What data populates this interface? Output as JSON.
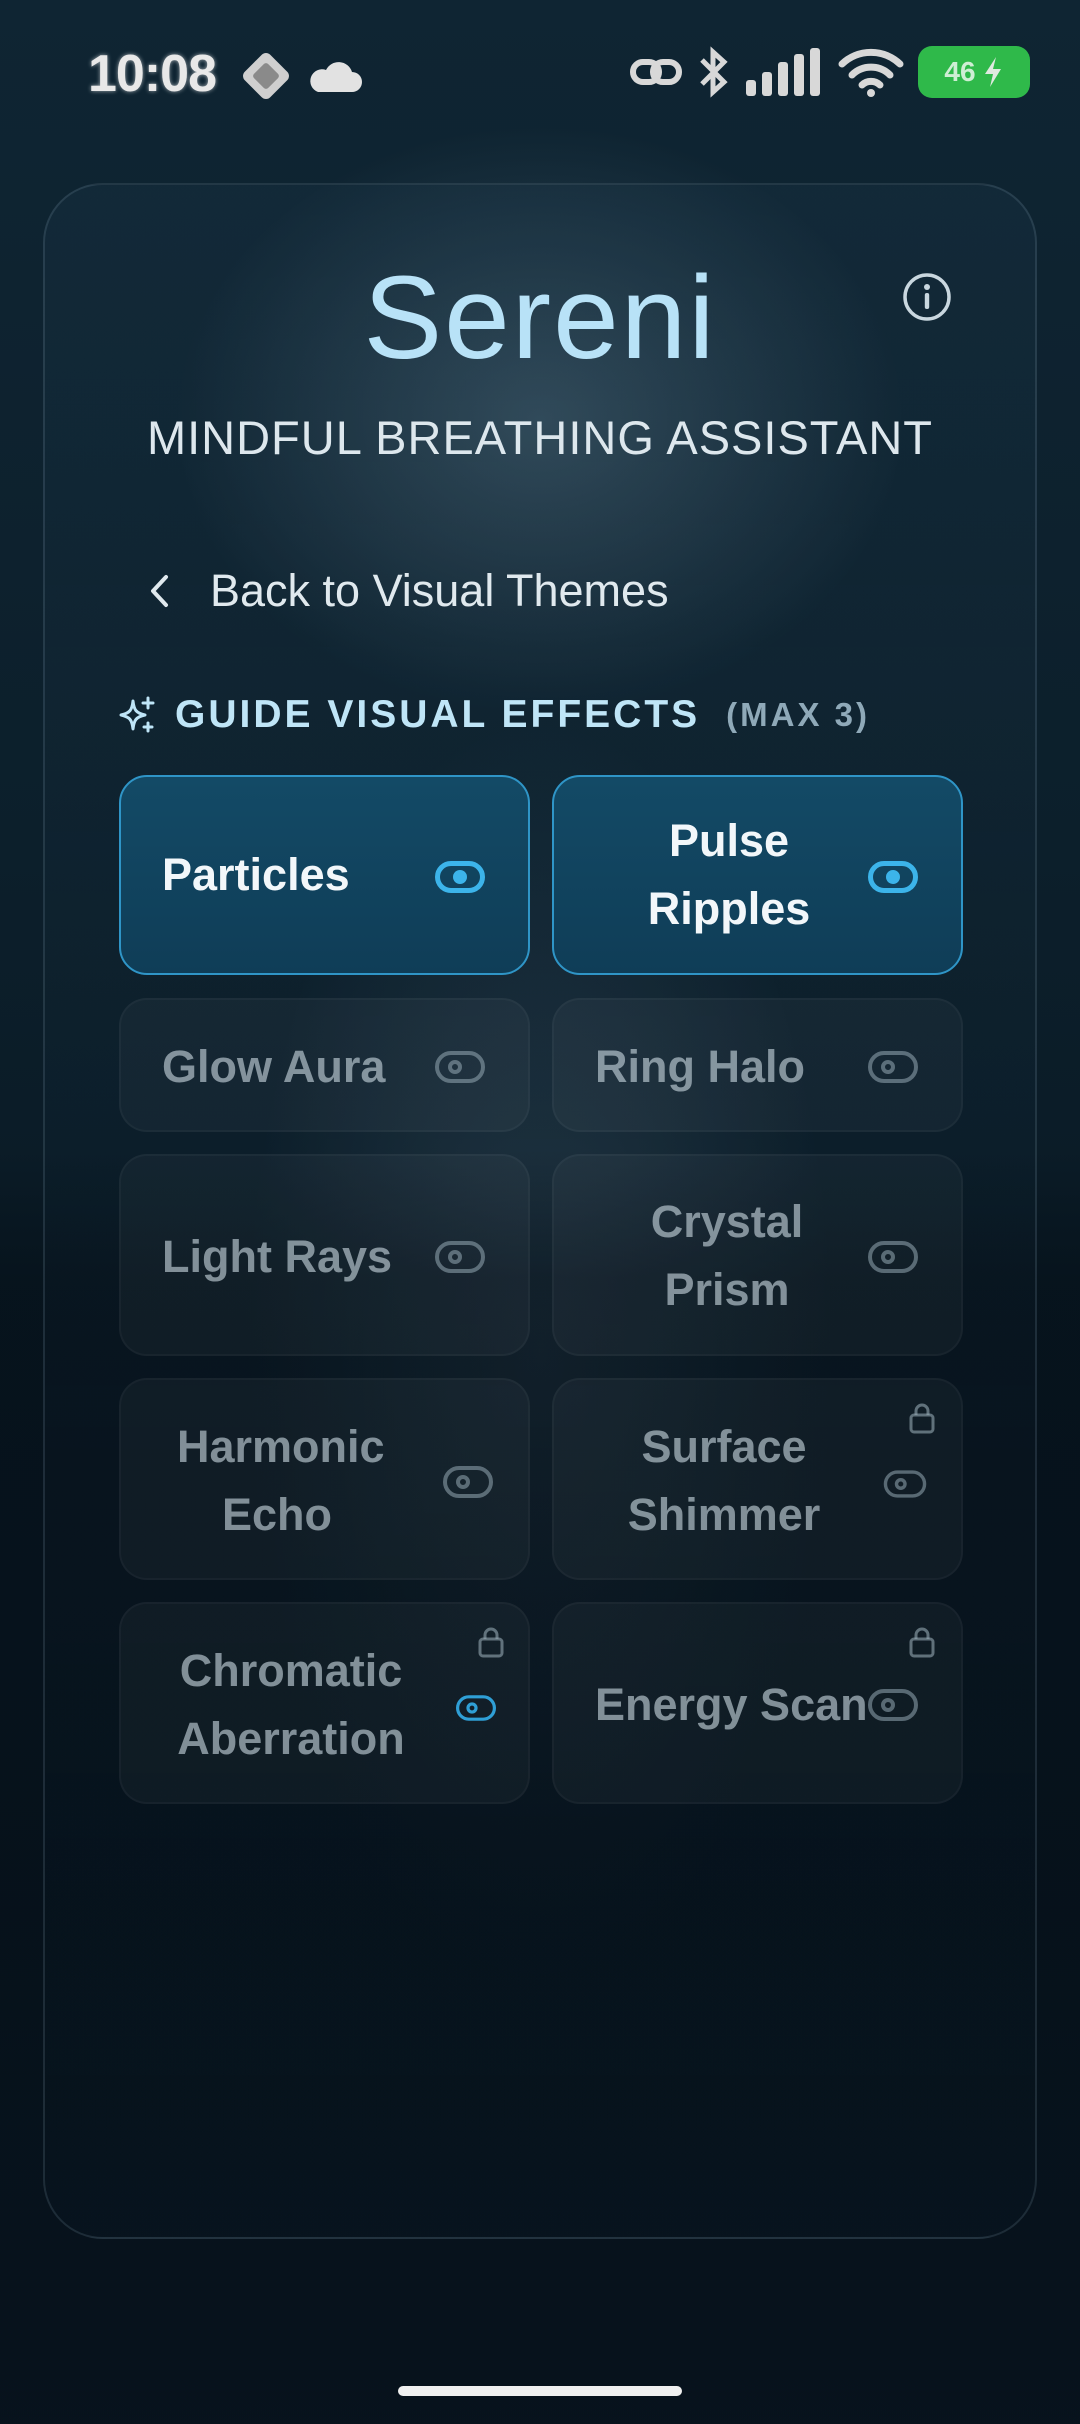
{
  "status_bar": {
    "time": "10:08",
    "battery": "46"
  },
  "header": {
    "title": "Sereni",
    "subtitle": "MINDFUL BREATHING ASSISTANT"
  },
  "nav": {
    "back_label": "Back to Visual Themes"
  },
  "section": {
    "title": "GUIDE VISUAL EFFECTS",
    "note": "(MAX 3)"
  },
  "effects": [
    {
      "label": "Particles",
      "enabled": true,
      "locked": false
    },
    {
      "label": "Pulse Ripples",
      "enabled": true,
      "locked": false
    },
    {
      "label": "Glow Aura",
      "enabled": false,
      "locked": false
    },
    {
      "label": "Ring Halo",
      "enabled": false,
      "locked": false
    },
    {
      "label": "Light Rays",
      "enabled": false,
      "locked": false
    },
    {
      "label": "Crystal Prism",
      "enabled": false,
      "locked": false
    },
    {
      "label": "Harmonic Echo",
      "enabled": false,
      "locked": false
    },
    {
      "label": "Surface Shimmer",
      "enabled": false,
      "locked": true
    },
    {
      "label": "Chromatic Aberration",
      "enabled": false,
      "locked": true
    },
    {
      "label": "Energy Scan",
      "enabled": false,
      "locked": true
    }
  ],
  "colors": {
    "accent": "#3cb4ea",
    "title": "#b8e2f7",
    "tile_active_bg": "#134a66",
    "battery": "#2fb94a"
  }
}
